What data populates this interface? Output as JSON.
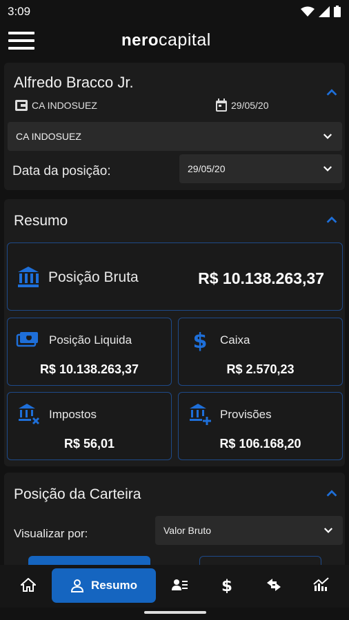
{
  "status_bar": {
    "time": "3:09"
  },
  "app": {
    "logo_left": "nero",
    "logo_right": "capital"
  },
  "client": {
    "name": "Alfredo Bracco Jr.",
    "bank": "CA INDOSUEZ",
    "date": "29/05/20",
    "bank_select": "CA INDOSUEZ",
    "date_label": "Data da posição:",
    "date_select": "29/05/20"
  },
  "resumo": {
    "title": "Resumo",
    "posicao_bruta": {
      "label": "Posição Bruta",
      "value": "R$ 10.138.263,37"
    },
    "posicao_liquida": {
      "label": "Posição Liquida",
      "value": "R$ 10.138.263,37"
    },
    "caixa": {
      "label": "Caixa",
      "value": "R$ 2.570,23"
    },
    "impostos": {
      "label": "Impostos",
      "value": "R$ 56,01"
    },
    "provisoes": {
      "label": "Provisões",
      "value": "R$ 106.168,20"
    }
  },
  "carteira": {
    "title": "Posição da Carteira",
    "view_label": "Visualizar por:",
    "view_select": "Valor Bruto"
  },
  "bottom_nav": {
    "active_label": "Resumo"
  },
  "colors": {
    "accent": "#1565c0",
    "tile_border": "#1e4a8a",
    "background": "#121212",
    "card": "#1c1c1c"
  }
}
